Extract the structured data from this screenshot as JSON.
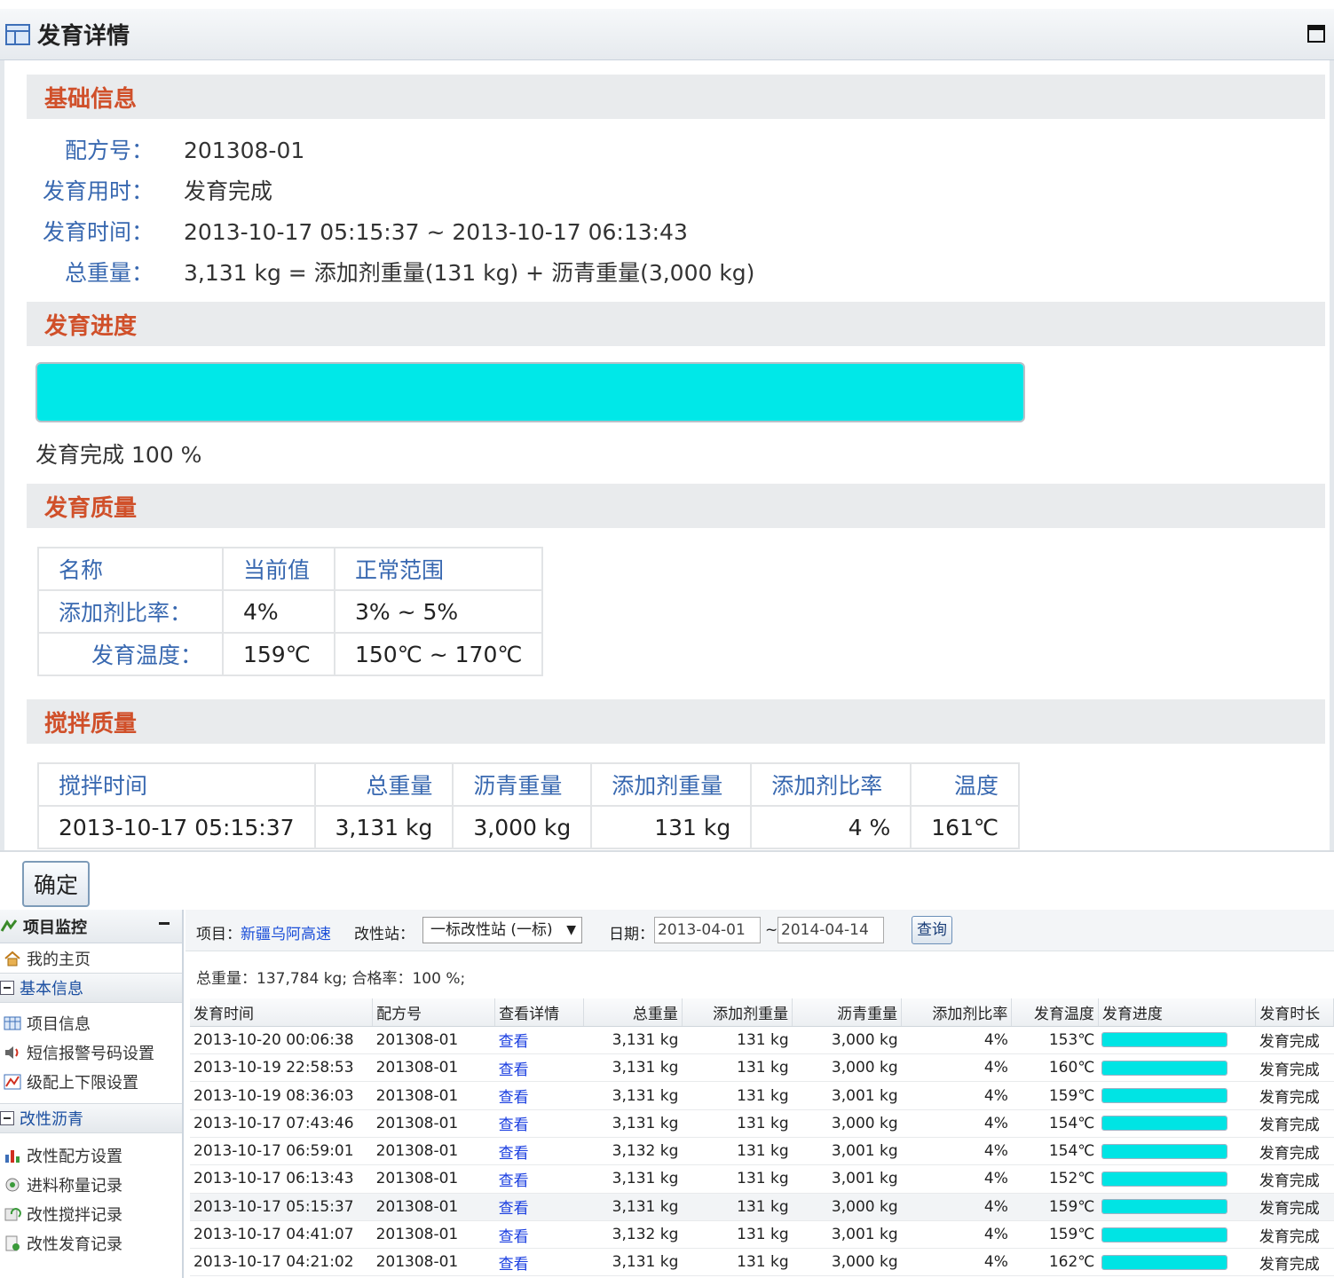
{
  "modal": {
    "title": "发育详情",
    "sections": {
      "basic": "基础信息",
      "progress": "发育进度",
      "quality": "发育质量",
      "mix": "搅拌质量"
    },
    "basic_info": [
      {
        "label": "配方号：",
        "value": "201308-01"
      },
      {
        "label": "发育用时：",
        "value": "发育完成"
      },
      {
        "label": "发育时间：",
        "value": "2013-10-17 05:15:37 ~ 2013-10-17 06:13:43"
      },
      {
        "label": "总重量：",
        "value": "3,131 kg = 添加剂重量(131 kg) + 沥青重量(3,000 kg)"
      }
    ],
    "progress": {
      "percent": 100,
      "status": "发育完成",
      "text": "100 %"
    },
    "quality_table": {
      "headers": [
        "名称",
        "当前值",
        "正常范围"
      ],
      "rows": [
        [
          "添加剂比率：",
          "4%",
          "3% ~ 5%"
        ],
        [
          "发育温度：",
          "159℃",
          "150℃ ~ 170℃"
        ]
      ]
    },
    "mix_table": {
      "headers": [
        "搅拌时间",
        "总重量",
        "沥青重量",
        "添加剂重量",
        "添加剂比率",
        "温度"
      ],
      "row": [
        "2013-10-17 05:15:37",
        "3,131 kg",
        "3,000 kg",
        "131 kg",
        "4 %",
        "161℃"
      ]
    },
    "ok_label": "确定"
  },
  "sidebar": {
    "title": "项目监控",
    "home": "我的主页",
    "groups": [
      {
        "label": "基本信息",
        "items": [
          "项目信息",
          "短信报警号码设置",
          "级配上下限设置"
        ]
      },
      {
        "label": "改性沥青",
        "items": [
          "改性配方设置",
          "进料称量记录",
          "改性搅拌记录",
          "改性发育记录"
        ]
      }
    ]
  },
  "toolbar": {
    "project_label": "项目：",
    "project_value": "新疆乌阿高速",
    "station_label": "改性站：",
    "station_value": "一标改性站 (一标)",
    "date_label": "日期：",
    "date_from": "2013-04-01",
    "date_sep": "~",
    "date_to": "2014-04-14",
    "query_label": "查询"
  },
  "summary": "总重量：137,784 kg; 合格率：100 %;",
  "grid": {
    "headers": [
      "发育时间",
      "配方号",
      "查看详情",
      "总重量",
      "添加剂重量",
      "沥青重量",
      "添加剂比率",
      "发育温度",
      "发育进度",
      "发育时长"
    ],
    "rows": [
      [
        "2013-10-20 00:06:38",
        "201308-01",
        "查看",
        "3,131 kg",
        "131 kg",
        "3,000 kg",
        "4%",
        "153℃",
        100,
        "发育完成"
      ],
      [
        "2013-10-19 22:58:53",
        "201308-01",
        "查看",
        "3,131 kg",
        "131 kg",
        "3,000 kg",
        "4%",
        "160℃",
        100,
        "发育完成"
      ],
      [
        "2013-10-19 08:36:03",
        "201308-01",
        "查看",
        "3,131 kg",
        "131 kg",
        "3,001 kg",
        "4%",
        "159℃",
        100,
        "发育完成"
      ],
      [
        "2013-10-17 07:43:46",
        "201308-01",
        "查看",
        "3,131 kg",
        "131 kg",
        "3,000 kg",
        "4%",
        "154℃",
        100,
        "发育完成"
      ],
      [
        "2013-10-17 06:59:01",
        "201308-01",
        "查看",
        "3,132 kg",
        "131 kg",
        "3,001 kg",
        "4%",
        "154℃",
        100,
        "发育完成"
      ],
      [
        "2013-10-17 06:13:43",
        "201308-01",
        "查看",
        "3,131 kg",
        "131 kg",
        "3,001 kg",
        "4%",
        "152℃",
        100,
        "发育完成"
      ],
      [
        "2013-10-17 05:15:37",
        "201308-01",
        "查看",
        "3,131 kg",
        "131 kg",
        "3,000 kg",
        "4%",
        "159℃",
        100,
        "发育完成"
      ],
      [
        "2013-10-17 04:41:07",
        "201308-01",
        "查看",
        "3,132 kg",
        "131 kg",
        "3,001 kg",
        "4%",
        "159℃",
        100,
        "发育完成"
      ],
      [
        "2013-10-17 04:21:02",
        "201308-01",
        "查看",
        "3,131 kg",
        "131 kg",
        "3,000 kg",
        "4%",
        "162℃",
        100,
        "发育完成"
      ]
    ],
    "selected_row": 6
  },
  "colors": {
    "accent_red": "#d0502a",
    "label_blue": "#3868b0",
    "progress_cyan": "#00e8e8",
    "link_blue": "#1a4ed8"
  }
}
